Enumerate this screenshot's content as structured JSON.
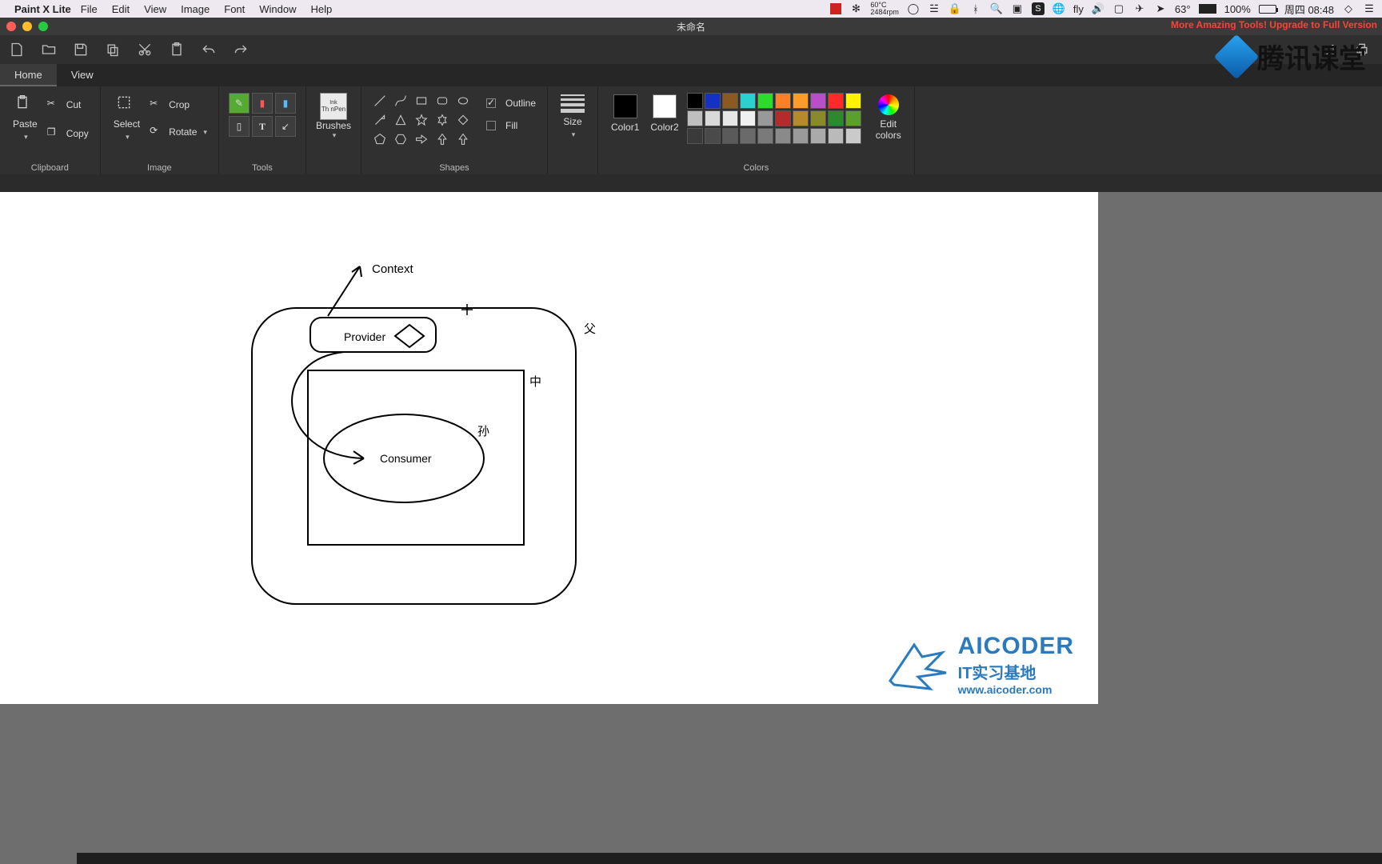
{
  "menubar": {
    "app_name": "Paint X Lite",
    "items": [
      "File",
      "Edit",
      "View",
      "Image",
      "Font",
      "Window",
      "Help"
    ]
  },
  "status": {
    "temp_cpu": "60°C",
    "fan_rpm": "2484rpm",
    "user_label": "fly",
    "outdoor_temp": "63°",
    "battery_pct": "100%",
    "battery_icon_label": "⚡",
    "day_time": "周四 08:48"
  },
  "window": {
    "title": "未命名",
    "upgrade_banner": "More Amazing Tools! Upgrade to Full Version"
  },
  "tabs": {
    "home": "Home",
    "view": "View"
  },
  "ribbon": {
    "clipboard_label": "Clipboard",
    "paste": "Paste",
    "cut": "Cut",
    "copy": "Copy",
    "image_label": "Image",
    "select": "Select",
    "crop": "Crop",
    "rotate": "Rotate",
    "tools_label": "Tools",
    "brushes_label": "Brushes",
    "brush_name": "Th nPen",
    "brush_caption_top": "Ink",
    "shapes_label": "Shapes",
    "outline": "Outline",
    "fill": "Fill",
    "size": "Size",
    "color1": "Color1",
    "color2": "Color2",
    "colors_label": "Colors",
    "edit_colors": "Edit\ncolors"
  },
  "colors": {
    "color1_hex": "#000000",
    "color2_hex": "#ffffff",
    "row1": [
      "#000000",
      "#1531c4",
      "#8a5a22",
      "#2bd1d1",
      "#2bdd2b",
      "#ff7f27",
      "#ff9c29",
      "#b84fc9",
      "#ff2b2b",
      "#fff200"
    ],
    "row2": [
      "#bfbfbf",
      "#d9d9d9",
      "#e6e6e6",
      "#f0f0f0",
      "#999999",
      "#b52b2b",
      "#b58a2b",
      "#8a8a2b",
      "#2b8a2b",
      "#5aa02b"
    ],
    "row3": [
      "#3a3a3a",
      "#4a4a4a",
      "#5a5a5a",
      "#6a6a6a",
      "#7a7a7a",
      "#8a8a8a",
      "#9a9a9a",
      "#aaaaaa",
      "#bababa",
      "#cacaca"
    ]
  },
  "canvas_text": {
    "context": "Context",
    "provider": "Provider",
    "consumer": "Consumer",
    "parent": "父",
    "middle": "中",
    "grand": "孙"
  },
  "watermarks": {
    "tencent": "腾讯课堂",
    "aicoder_main": "AICODER",
    "aicoder_sub": "IT实习基地",
    "aicoder_url": "www.aicoder.com"
  }
}
